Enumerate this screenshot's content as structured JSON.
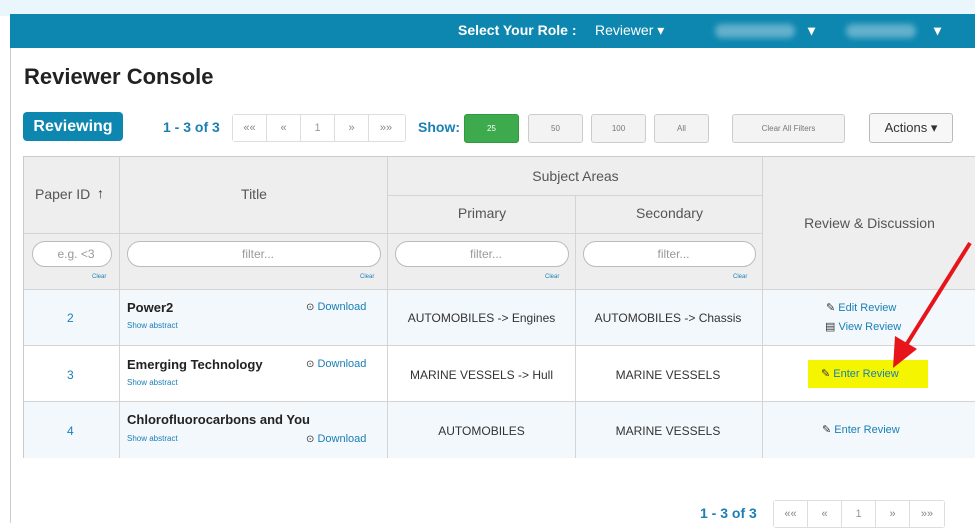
{
  "topbar": {
    "role_label": "Select Your Role :",
    "role_value": "Reviewer",
    "caret": "▾"
  },
  "page": {
    "title": "Reviewer Console",
    "tab_label": "Reviewing"
  },
  "pagination": {
    "range_text": "1 - 3 of 3",
    "buttons": [
      "««",
      "«",
      "1",
      "»",
      "»»"
    ]
  },
  "show": {
    "label": "Show:",
    "options": [
      "25",
      "50",
      "100",
      "All"
    ],
    "selected": "25"
  },
  "toolbar": {
    "clear_filters_label": "Clear All Filters",
    "actions_label": "Actions ▾"
  },
  "table": {
    "headers": {
      "paper_id": "Paper ID",
      "sort_icon": "↑",
      "title": "Title",
      "subject_areas": "Subject Areas",
      "primary": "Primary",
      "secondary": "Secondary",
      "review": "Review & Discussion"
    },
    "filters": {
      "paper_id_placeholder": "e.g. <3",
      "title_placeholder": "filter...",
      "primary_placeholder": "filter...",
      "secondary_placeholder": "filter...",
      "clear_label": "Clear"
    },
    "rows": [
      {
        "id": "2",
        "title": "Power2",
        "show_abstract": "Show abstract",
        "download": "Download",
        "primary": "AUTOMOBILES -> Engines",
        "secondary": "AUTOMOBILES -> Chassis",
        "actions": [
          "Edit Review",
          "View Review"
        ]
      },
      {
        "id": "3",
        "title": "Emerging Technology",
        "show_abstract": "Show abstract",
        "download": "Download",
        "primary": "MARINE VESSELS -> Hull",
        "secondary": "MARINE VESSELS",
        "actions": [
          "Enter Review"
        ]
      },
      {
        "id": "4",
        "title": "Chlorofluorocarbons and You",
        "show_abstract": "Show abstract",
        "download": "Download",
        "primary": "AUTOMOBILES",
        "secondary": "MARINE VESSELS",
        "actions": [
          "Enter Review"
        ]
      }
    ]
  },
  "colors": {
    "brand": "#0e87b0",
    "active_green": "#3caa4d",
    "highlight": "#f5f500",
    "annotation_arrow": "#e8141c"
  },
  "icons": {
    "download": "download-icon",
    "edit": "edit-icon",
    "view": "view-icon",
    "sort": "sort-up-icon"
  }
}
